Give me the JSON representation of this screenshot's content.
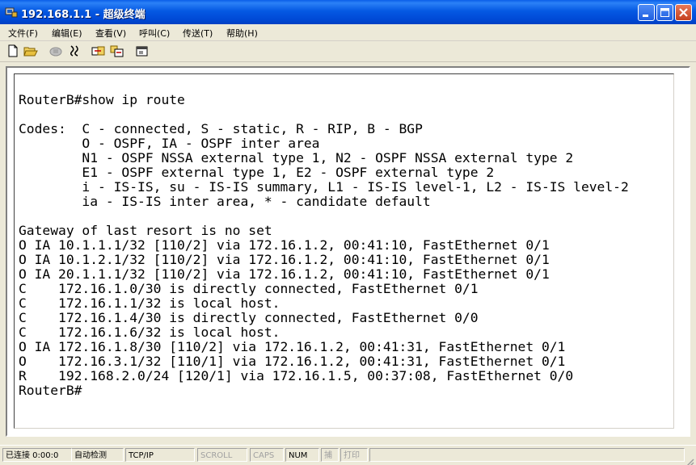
{
  "window": {
    "title": "192.168.1.1 - 超级终端",
    "accent_color": "#0a5ee8",
    "controls": [
      "minimize-icon",
      "maximize-icon",
      "close-icon"
    ]
  },
  "menu": {
    "items": [
      "文件(F)",
      "编辑(E)",
      "查看(V)",
      "呼叫(C)",
      "传送(T)",
      "帮助(H)"
    ]
  },
  "toolbar": {
    "icons": [
      "new-connection-icon",
      "open-icon",
      "call-icon",
      "disconnect-icon",
      "send-icon",
      "receive-icon",
      "properties-icon"
    ]
  },
  "terminal": {
    "lines": [
      "",
      "RouterB#show ip route",
      "",
      "Codes:  C - connected, S - static, R - RIP, B - BGP",
      "        O - OSPF, IA - OSPF inter area",
      "        N1 - OSPF NSSA external type 1, N2 - OSPF NSSA external type 2",
      "        E1 - OSPF external type 1, E2 - OSPF external type 2",
      "        i - IS-IS, su - IS-IS summary, L1 - IS-IS level-1, L2 - IS-IS level-2",
      "        ia - IS-IS inter area, * - candidate default",
      "",
      "Gateway of last resort is no set",
      "O IA 10.1.1.1/32 [110/2] via 172.16.1.2, 00:41:10, FastEthernet 0/1",
      "O IA 10.1.2.1/32 [110/2] via 172.16.1.2, 00:41:10, FastEthernet 0/1",
      "O IA 20.1.1.1/32 [110/2] via 172.16.1.2, 00:41:10, FastEthernet 0/1",
      "C    172.16.1.0/30 is directly connected, FastEthernet 0/1",
      "C    172.16.1.1/32 is local host.",
      "C    172.16.1.4/30 is directly connected, FastEthernet 0/0",
      "C    172.16.1.6/32 is local host.",
      "O IA 172.16.1.8/30 [110/2] via 172.16.1.2, 00:41:31, FastEthernet 0/1",
      "O    172.16.3.1/32 [110/1] via 172.16.1.2, 00:41:31, FastEthernet 0/1",
      "R    192.168.2.0/24 [120/1] via 172.16.1.5, 00:37:08, FastEthernet 0/0",
      "RouterB#"
    ]
  },
  "status": {
    "connected": "已连接 0:00:0",
    "detect": "自动检测",
    "protocol": "TCP/IP",
    "scroll": "SCROLL",
    "caps": "CAPS",
    "num": "NUM",
    "capture": "捕",
    "print": "打印"
  }
}
